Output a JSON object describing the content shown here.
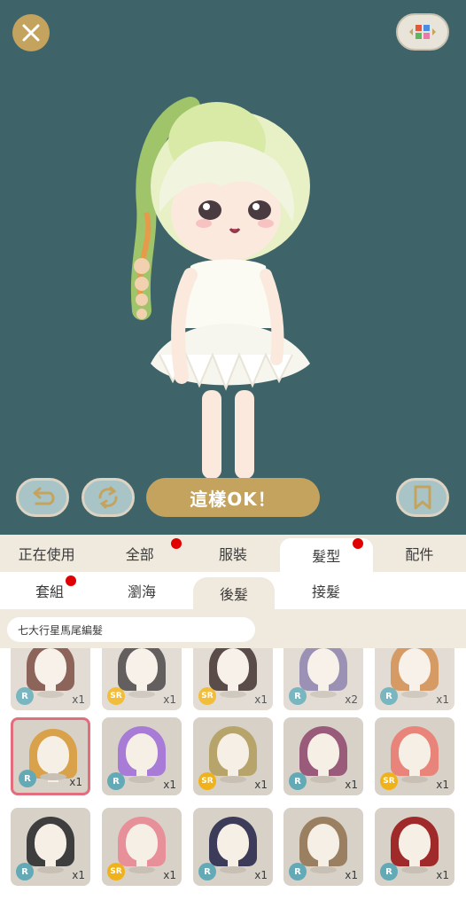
{
  "stage": {
    "close_icon": "close-icon",
    "layout_icon": "color-grid-icon",
    "undo_icon": "undo-icon",
    "random_icon": "refresh-icon",
    "ok_label": "這樣OK！",
    "bookmark_icon": "bookmark-icon"
  },
  "category_tabs": [
    {
      "label": "正在使用",
      "active": false,
      "dot": false
    },
    {
      "label": "全部",
      "active": false,
      "dot": true
    },
    {
      "label": "服裝",
      "active": false,
      "dot": false
    },
    {
      "label": "髮型",
      "active": true,
      "dot": true
    },
    {
      "label": "配件",
      "active": false,
      "dot": false
    }
  ],
  "sub_tabs": [
    {
      "label": "套組",
      "active": false,
      "dot": true
    },
    {
      "label": "瀏海",
      "active": false,
      "dot": false
    },
    {
      "label": "後髮",
      "active": true,
      "dot": false
    },
    {
      "label": "接髮",
      "active": false,
      "dot": false
    }
  ],
  "filter": {
    "label": "七大行星馬尾編髮"
  },
  "items": [
    {
      "rarity": "R",
      "qty": "x1",
      "hair": "#7a4a3e",
      "dim": true,
      "selected": false
    },
    {
      "rarity": "SR",
      "qty": "x1",
      "hair": "#4a4444",
      "dim": true,
      "selected": false
    },
    {
      "rarity": "SR",
      "qty": "x1",
      "hair": "#3e2e2a",
      "dim": true,
      "selected": false
    },
    {
      "rarity": "R",
      "qty": "x2",
      "hair": "#8a7ea8",
      "dim": true,
      "selected": false
    },
    {
      "rarity": "R",
      "qty": "x1",
      "hair": "#d08a4a",
      "dim": true,
      "selected": false
    },
    {
      "rarity": "R",
      "qty": "x1",
      "hair": "#d9a24a",
      "dim": false,
      "selected": true
    },
    {
      "rarity": "R",
      "qty": "x1",
      "hair": "#a77bd6",
      "dim": false,
      "selected": false
    },
    {
      "rarity": "SR",
      "qty": "x1",
      "hair": "#b7a46a",
      "dim": false,
      "selected": false
    },
    {
      "rarity": "R",
      "qty": "x1",
      "hair": "#9a5a7a",
      "dim": false,
      "selected": false
    },
    {
      "rarity": "SR",
      "qty": "x1",
      "hair": "#e8847a",
      "dim": false,
      "selected": false
    },
    {
      "rarity": "R",
      "qty": "x1",
      "hair": "#3e3e3e",
      "dim": false,
      "selected": false
    },
    {
      "rarity": "SR",
      "qty": "x1",
      "hair": "#e8909a",
      "dim": false,
      "selected": false
    },
    {
      "rarity": "R",
      "qty": "x1",
      "hair": "#3c3c5a",
      "dim": false,
      "selected": false
    },
    {
      "rarity": "R",
      "qty": "x1",
      "hair": "#9a8060",
      "dim": false,
      "selected": false
    },
    {
      "rarity": "R",
      "qty": "x1",
      "hair": "#a02a2a",
      "dim": false,
      "selected": false
    }
  ]
}
